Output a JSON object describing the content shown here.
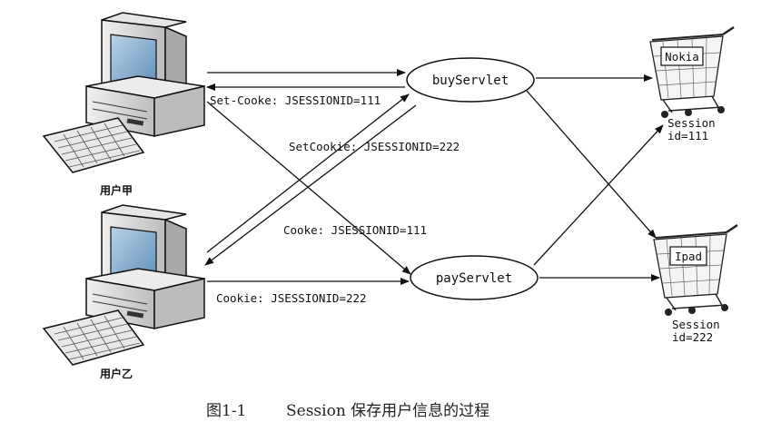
{
  "users": {
    "jia": "用户甲",
    "yi": "用户乙"
  },
  "servlets": {
    "buy": "buyServlet",
    "pay": "payServlet"
  },
  "carts": {
    "cart1": {
      "item": "Nokia",
      "session_line1": "Session",
      "session_line2": "id=111"
    },
    "cart2": {
      "item": "Ipad",
      "session_line1": "Session",
      "session_line2": "id=222"
    }
  },
  "messages": {
    "set_cooke_111": "Set-Cooke: JSESSIONID=111",
    "setcookie_222": "SetCookie: JSESSIONID=222",
    "cooke_111": "Cooke: JSESSIONID=111",
    "cookie_222": "Cookie: JSESSIONID=222"
  },
  "caption": {
    "figure_no": "图1-1",
    "text": "Session 保存用户信息的过程"
  },
  "colors": {
    "stroke": "#111111",
    "monitor_body": "#dcdcdc",
    "screen": "#8fb6d6"
  },
  "icons": [
    "computer-icon",
    "keyboard-icon",
    "shopping-cart-icon"
  ]
}
